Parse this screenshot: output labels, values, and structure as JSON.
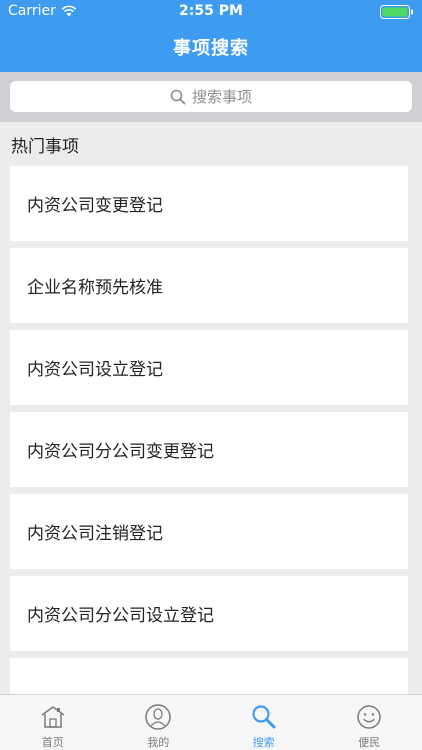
{
  "status_bar": {
    "carrier": "Carrier",
    "time": "2:55 PM"
  },
  "header": {
    "title": "事项搜索"
  },
  "search": {
    "placeholder": "搜索事项"
  },
  "hot": {
    "title": "热门事项",
    "items": [
      "内资公司变更登记",
      "企业名称预先核准",
      "内资公司设立登记",
      "内资公司分公司变更登记",
      "内资公司注销登记",
      "内资公司分公司设立登记",
      ""
    ]
  },
  "tabbar": {
    "tabs": [
      {
        "label": "首页",
        "icon": "home-icon"
      },
      {
        "label": "我的",
        "icon": "user-icon"
      },
      {
        "label": "搜索",
        "icon": "search-icon"
      },
      {
        "label": "便民",
        "icon": "smiley-icon"
      }
    ],
    "active_color": "#3e9cf0",
    "inactive_color": "#7a7a7a"
  },
  "colors": {
    "header": "#3e9cf0",
    "background": "#ececec"
  }
}
